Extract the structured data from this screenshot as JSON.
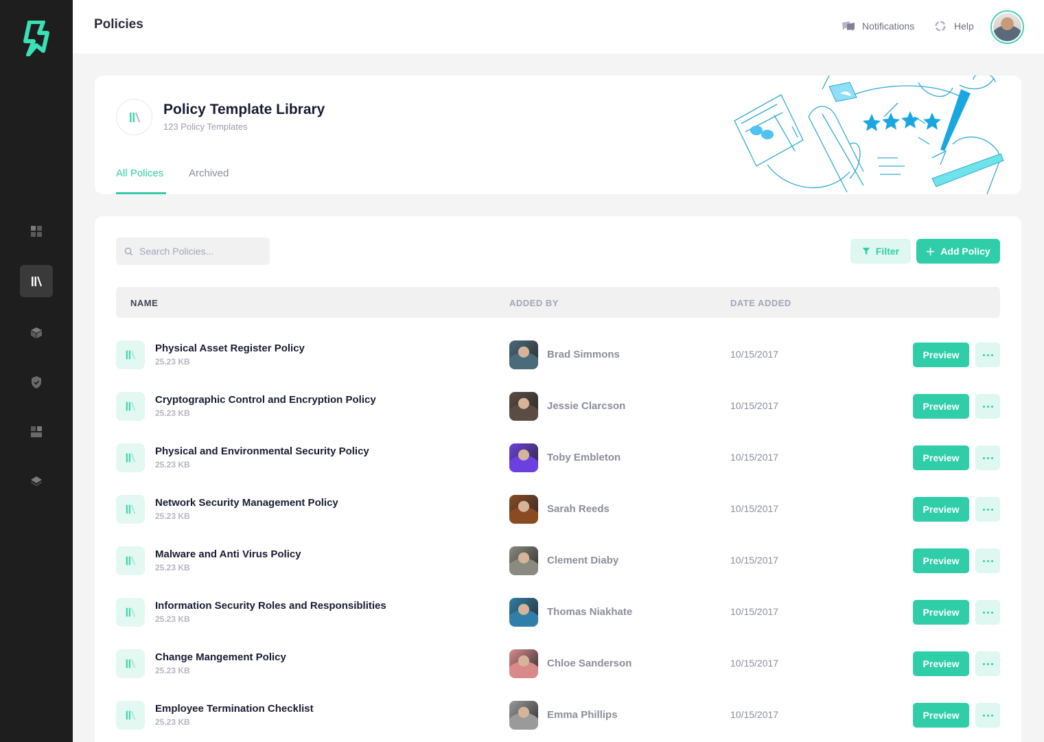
{
  "app": {
    "page_title": "Policies",
    "brand_icon": "lightning-bolt-logo",
    "accent_color": "#2fcda8"
  },
  "sidebar": {
    "items": [
      {
        "icon": "dashboard-grid-icon",
        "active": false
      },
      {
        "icon": "library-icon",
        "active": true
      },
      {
        "icon": "cube-icon",
        "active": false
      },
      {
        "icon": "shield-check-icon",
        "active": false
      },
      {
        "icon": "layout-icon",
        "active": false
      },
      {
        "icon": "layers-icon",
        "active": false
      }
    ]
  },
  "header": {
    "notifications_label": "Notifications",
    "help_label": "Help"
  },
  "library": {
    "title": "Policy Template Library",
    "subtitle": "123 Policy Templates",
    "tabs": [
      {
        "label": "All Polices",
        "active": true
      },
      {
        "label": "Archived",
        "active": false
      }
    ]
  },
  "toolbar": {
    "search_placeholder": "Search Policies...",
    "filter_label": "Filter",
    "add_label": "Add Policy"
  },
  "table": {
    "columns": [
      "NAME",
      "ADDED BY",
      "DATE ADDED"
    ],
    "preview_label": "Preview",
    "rows": [
      {
        "name": "Physical Asset Register Policy",
        "size": "25.23 KB",
        "added_by": "Brad Simmons",
        "date": "10/15/2017",
        "avatar_color": "#4a6b7a"
      },
      {
        "name": "Cryptographic Control and Encryption Policy",
        "size": "25.23 KB",
        "added_by": "Jessie Clarcson",
        "date": "10/15/2017",
        "avatar_color": "#5a4c44"
      },
      {
        "name": "Physical and Environmental Security Policy",
        "size": "25.23 KB",
        "added_by": "Toby Embleton",
        "date": "10/15/2017",
        "avatar_color": "#6b3fe0"
      },
      {
        "name": "Network Security Management Policy",
        "size": "25.23 KB",
        "added_by": "Sarah Reeds",
        "date": "10/15/2017",
        "avatar_color": "#8a4a22"
      },
      {
        "name": "Malware and Anti Virus Policy",
        "size": "25.23 KB",
        "added_by": "Clement Diaby",
        "date": "10/15/2017",
        "avatar_color": "#8a8a80"
      },
      {
        "name": "Information Security Roles and Responsiblities",
        "size": "25.23 KB",
        "added_by": "Thomas Niakhate",
        "date": "10/15/2017",
        "avatar_color": "#2f7fa8"
      },
      {
        "name": "Change Mangement Policy",
        "size": "25.23 KB",
        "added_by": "Chloe Sanderson",
        "date": "10/15/2017",
        "avatar_color": "#d88a8a"
      },
      {
        "name": "Employee Termination Checklist",
        "size": "25.23 KB",
        "added_by": "Emma Phillips",
        "date": "10/15/2017",
        "avatar_color": "#9a9a9a"
      }
    ]
  }
}
